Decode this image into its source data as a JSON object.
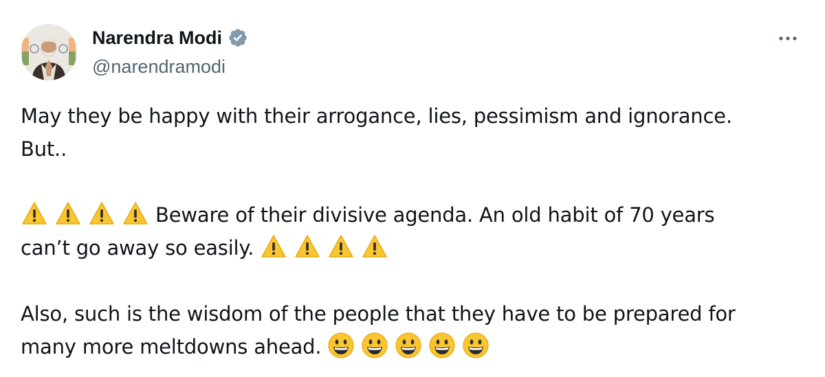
{
  "author": {
    "display_name": "Narendra Modi",
    "handle": "@narendramodi",
    "verified": true,
    "avatar_icon": "profile-photo",
    "verified_icon": "verified-badge-icon"
  },
  "menu": {
    "icon": "more-options-icon",
    "label": "•••"
  },
  "tweet": {
    "line1": "May they be happy with their arrogance, lies, pessimism and ignorance.",
    "line2": "But..",
    "warning_emoji": "⚠️",
    "warning_text_a": " Beware of their divisive agenda. An old habit of 70 years",
    "warning_text_b": "can’t go away so easily. ",
    "also_a": "Also, such is the wisdom of the people that they have to be prepared for",
    "also_b": "many more meltdowns ahead. ",
    "smiley_emoji": "😃"
  },
  "colors": {
    "text": "#0f1419",
    "secondary": "#536471",
    "verified": "#829aab",
    "warning": "#f9c531"
  }
}
